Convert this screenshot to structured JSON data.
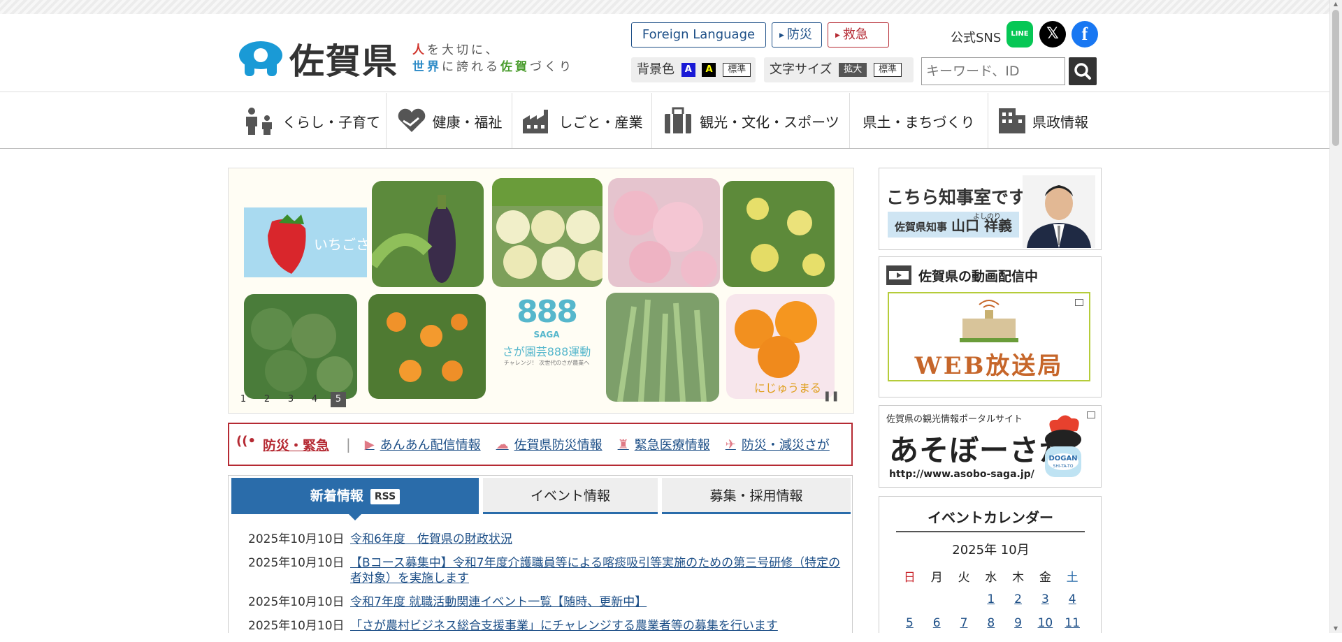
{
  "header": {
    "logo_text": "佐賀県",
    "slogan_line1": [
      "人",
      "を大切に、"
    ],
    "slogan_line2": [
      "世界",
      "に誇れる",
      "佐賀",
      "づくり"
    ],
    "foreign_language": "Foreign Language",
    "bosai": "防災",
    "kyukyu": "救急",
    "sns_label": "公式SNS",
    "sns_line": "LINE",
    "sns_x": "𝕏",
    "sns_fb": "f",
    "bg_label": "背景色",
    "bg_blue": "A",
    "bg_black": "A",
    "bg_standard": "標準",
    "font_label": "文字サイズ",
    "font_large": "拡大",
    "font_standard": "標準",
    "search_placeholder": "キーワード、ID"
  },
  "gnav": [
    {
      "label": "くらし・子育て",
      "icon": "family-icon"
    },
    {
      "label": "健康・福祉",
      "icon": "heart-hands-icon"
    },
    {
      "label": "しごと・産業",
      "icon": "factory-icon"
    },
    {
      "label": "観光・文化・スポーツ",
      "icon": "suitcase-icon"
    },
    {
      "label": "県土・まちづくり",
      "icon": ""
    },
    {
      "label": "県政情報",
      "icon": "building-icon"
    }
  ],
  "slider": {
    "dots": [
      "1",
      "2",
      "3",
      "4",
      "5"
    ],
    "active_dot": 5,
    "badge_text": "さが園芸888運動",
    "badge_sub": "SAGA",
    "badge_small": "チャレンジ！ 次世代のさが農業へ",
    "strawberry_label": "いちごさん",
    "mikan_label": "にじゅうまる"
  },
  "emergency": {
    "title": "防災・緊急",
    "links": [
      {
        "label": "あんあん配信情報",
        "icon": "megaphone-icon"
      },
      {
        "label": "佐賀県防災情報",
        "icon": "cloud-rain-icon"
      },
      {
        "label": "緊急医療情報",
        "icon": "medical-icon"
      },
      {
        "label": "防災・減災さが",
        "icon": "runner-icon"
      }
    ]
  },
  "news": {
    "tabs": [
      "新着情報",
      "イベント情報",
      "募集・採用情報"
    ],
    "rss": "RSS",
    "items": [
      {
        "date": "2025年10月10日",
        "title": "令和6年度　佐賀県の財政状況"
      },
      {
        "date": "2025年10月10日",
        "title": "【Bコース募集中】令和7年度介護職員等による喀痰吸引等実施のための第三号研修（特定の者対象）を実施します"
      },
      {
        "date": "2025年10月10日",
        "title": "令和7年度 就職活動関連イベント一覧【随時、更新中】"
      },
      {
        "date": "2025年10月10日",
        "title": "「さが農村ビジネス総合支援事業」にチャレンジする農業者等の募集を行います"
      }
    ]
  },
  "side": {
    "governor_title": "こちら知事室です",
    "governor_role": "佐賀県知事",
    "governor_name": "山口 祥義",
    "governor_ruby": "よしのり",
    "video_title": "佐賀県の動画配信中",
    "video_banner": "WEB放送局",
    "tour_small": "佐賀県の観光情報ポータルサイト",
    "tour_big": "あそぼーさが",
    "tour_url": "http://www.asobo-saga.jp/",
    "tour_badge": "DOGAN SHI-TA-TO",
    "calendar_title": "イベントカレンダー",
    "calendar_month": "2025年 10月",
    "weekdays": [
      "日",
      "月",
      "火",
      "水",
      "木",
      "金",
      "土"
    ],
    "weeks": [
      [
        "",
        "",
        "",
        "1",
        "2",
        "3",
        "4"
      ],
      [
        "5",
        "6",
        "7",
        "8",
        "9",
        "10",
        "11"
      ]
    ]
  },
  "colors": {
    "accent_blue": "#2a6caa",
    "emergency_red": "#b52a33",
    "link": "#1d4f87"
  }
}
